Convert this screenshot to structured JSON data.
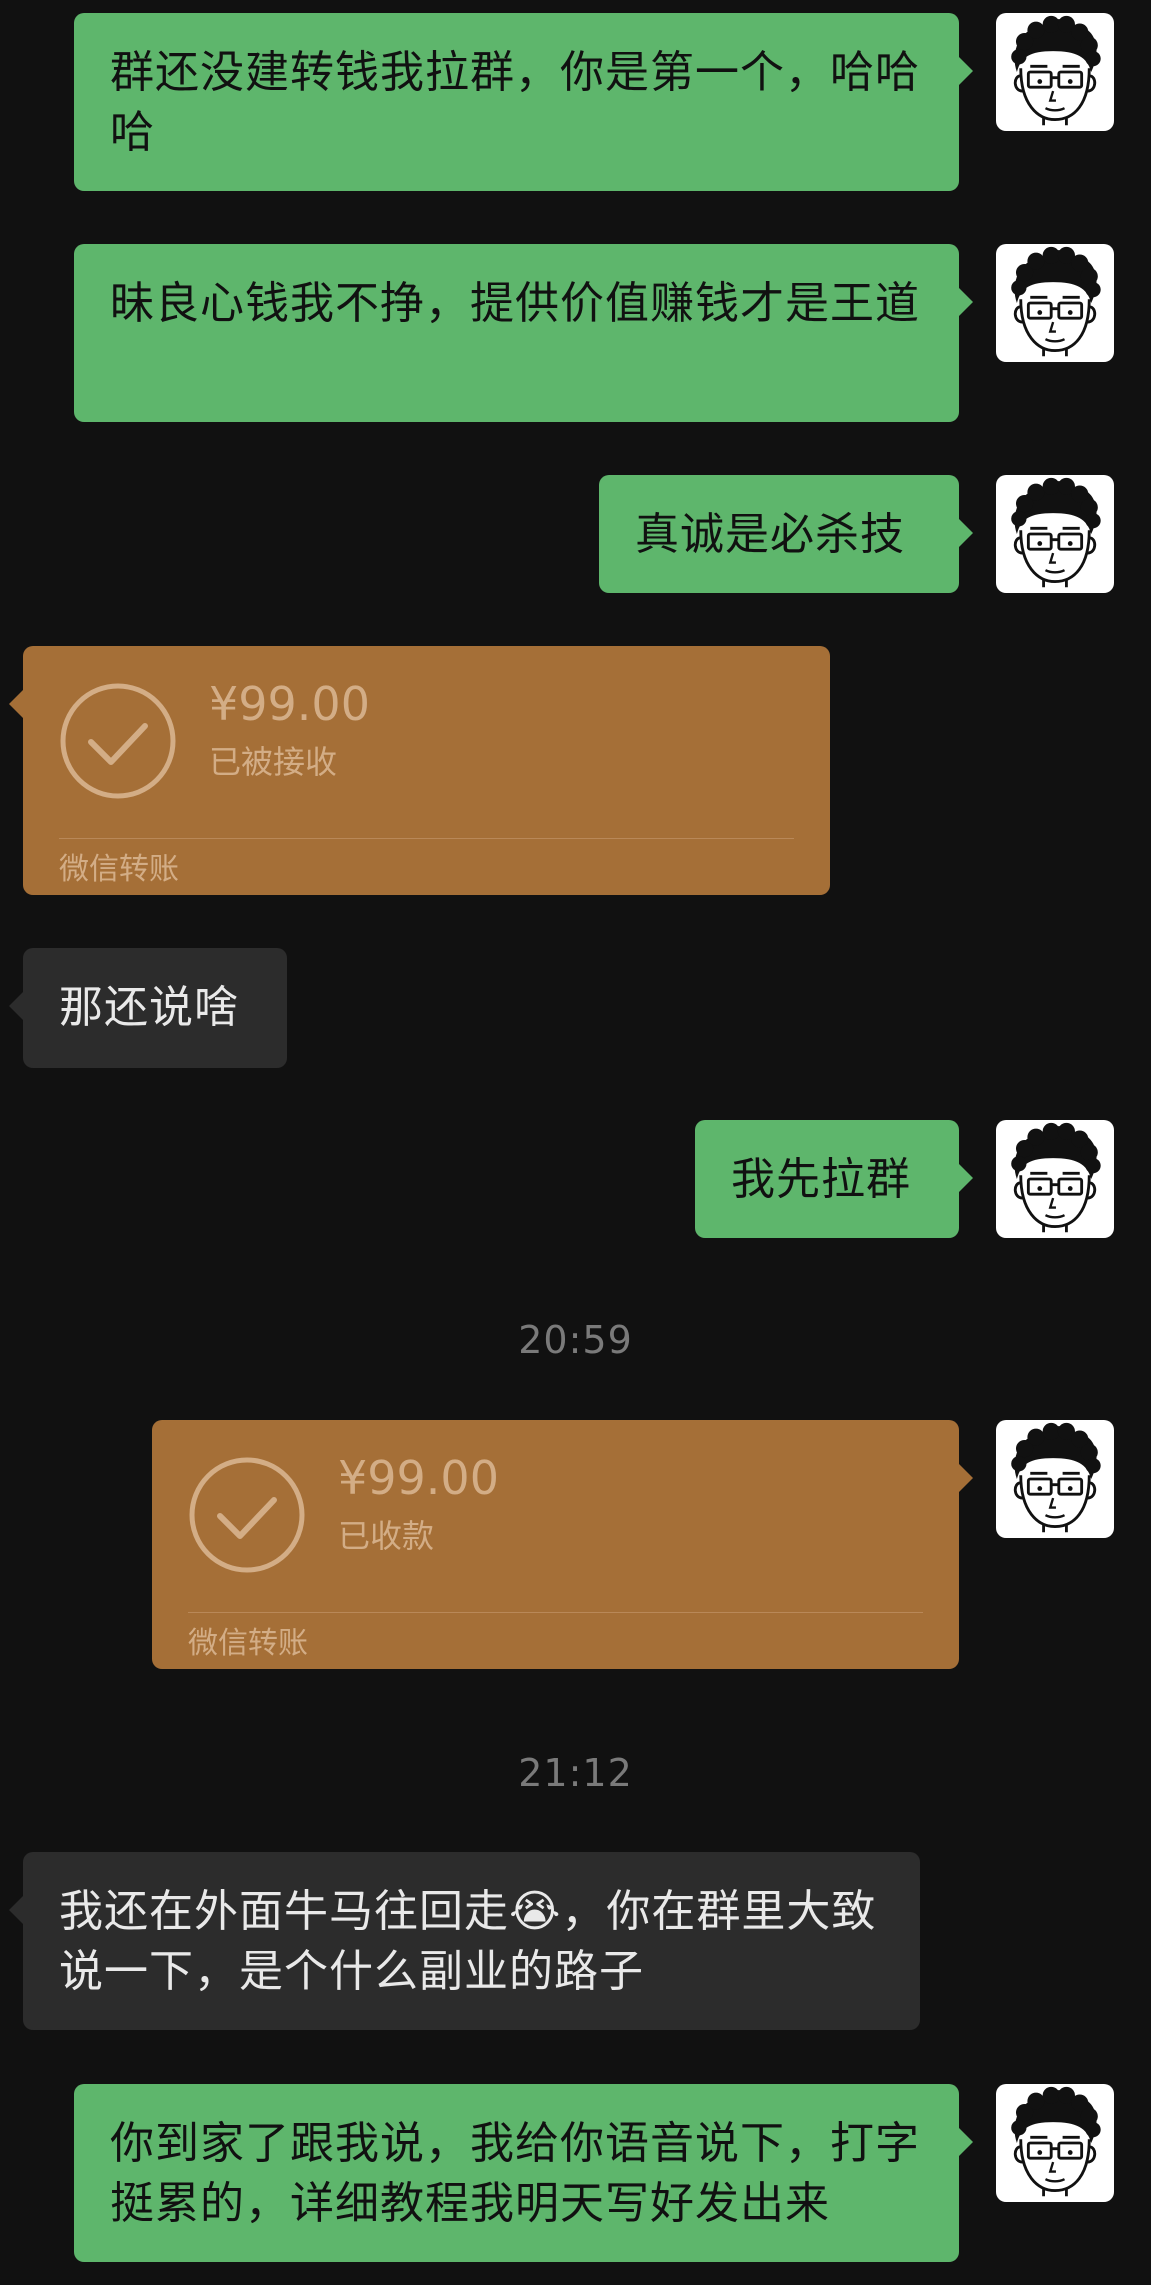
{
  "messages": [
    {
      "id": "m1",
      "side": "out",
      "text": "群还没建转钱我拉群，你是第一个，哈哈哈"
    },
    {
      "id": "m2",
      "side": "out",
      "text": "昧良心钱我不挣，提供价值赚钱才是王道"
    },
    {
      "id": "m3",
      "side": "out",
      "text": "真诚是必杀技"
    },
    {
      "id": "t1",
      "side": "in",
      "type": "transfer",
      "amount": "¥99.00",
      "status": "已被接收",
      "label": "微信转账"
    },
    {
      "id": "m4",
      "side": "in",
      "text": "那还说啥"
    },
    {
      "id": "m5",
      "side": "out",
      "text": "我先拉群"
    },
    {
      "id": "ts1",
      "type": "timestamp",
      "text": "20:59"
    },
    {
      "id": "t2",
      "side": "out",
      "type": "transfer",
      "amount": "¥99.00",
      "status": "已收款",
      "label": "微信转账"
    },
    {
      "id": "ts2",
      "type": "timestamp",
      "text": "21:12"
    },
    {
      "id": "m6",
      "side": "in",
      "text_before": "我还在外面牛马往回走",
      "emoji": "😭",
      "text_after": "，你在群里大致说一下，是个什么副业的路子"
    },
    {
      "id": "m7",
      "side": "out",
      "text": "你到家了跟我说，我给你语音说下，打字挺累的，详细教程我明天写好发出来"
    }
  ],
  "avatar_icon": "cartoon-man-with-glasses-icon",
  "transfer_icon": "check-circle-icon",
  "colors": {
    "background": "#111111",
    "outgoing_bubble": "#5eb66c",
    "incoming_bubble": "#2c2c2c",
    "transfer_card": "#a56f37",
    "transfer_text": "#d3ad86",
    "timestamp_text": "#7a7a7a"
  }
}
